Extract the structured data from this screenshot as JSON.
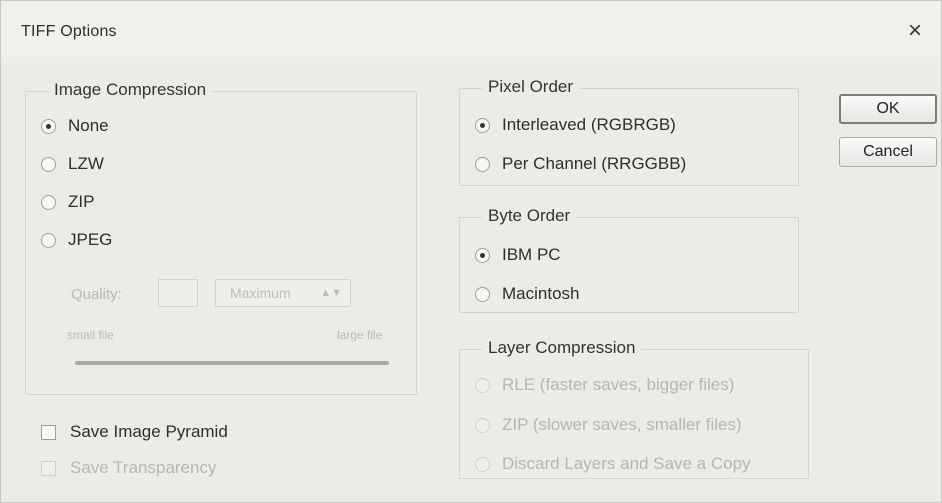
{
  "window": {
    "title": "TIFF Options",
    "close_glyph": "×"
  },
  "image_compression": {
    "legend": "Image Compression",
    "options": [
      {
        "label": "None",
        "checked": true
      },
      {
        "label": "LZW",
        "checked": false
      },
      {
        "label": "ZIP",
        "checked": false
      },
      {
        "label": "JPEG",
        "checked": false
      }
    ],
    "quality": {
      "label": "Quality:",
      "value": "",
      "preset": "Maximum",
      "small_file_label": "small file",
      "large_file_label": "large file"
    }
  },
  "pixel_order": {
    "legend": "Pixel Order",
    "options": [
      {
        "label": "Interleaved (RGBRGB)",
        "checked": true
      },
      {
        "label": "Per Channel (RRGGBB)",
        "checked": false
      }
    ]
  },
  "byte_order": {
    "legend": "Byte Order",
    "options": [
      {
        "label": "IBM PC",
        "checked": true
      },
      {
        "label": "Macintosh",
        "checked": false
      }
    ]
  },
  "layer_compression": {
    "legend": "Layer Compression",
    "options": [
      {
        "label": "RLE (faster saves, bigger files)",
        "checked": false
      },
      {
        "label": "ZIP (slower saves, smaller files)",
        "checked": false
      },
      {
        "label": "Discard Layers and Save a Copy",
        "checked": false
      }
    ]
  },
  "checkboxes": {
    "save_image_pyramid": "Save Image Pyramid",
    "save_transparency": "Save Transparency"
  },
  "buttons": {
    "ok": "OK",
    "cancel": "Cancel"
  }
}
